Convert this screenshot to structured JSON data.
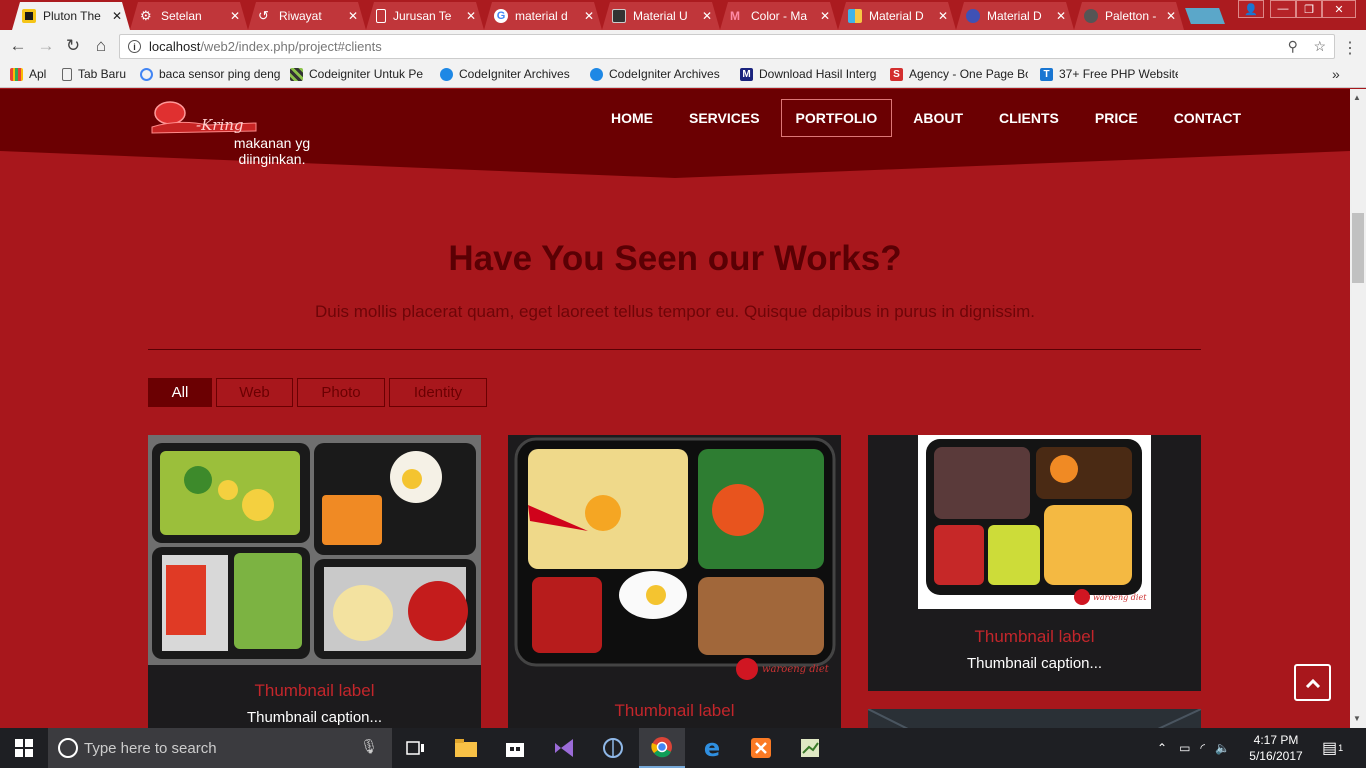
{
  "browser": {
    "tabs": [
      {
        "title": "Pluton The",
        "icon": "pluton-favicon-icon",
        "color": "#f5c518",
        "active": true
      },
      {
        "title": "Setelan",
        "icon": "gear-icon",
        "color": "#ffffff"
      },
      {
        "title": "Riwayat",
        "icon": "history-icon",
        "color": "#ffffff"
      },
      {
        "title": "Jurusan Te",
        "icon": "document-icon",
        "color": "#ffffff"
      },
      {
        "title": "material d",
        "icon": "google-icon",
        "color": "#4285f4"
      },
      {
        "title": "Material U",
        "icon": "book-icon",
        "color": "#333333"
      },
      {
        "title": "Color - Ma",
        "icon": "material-color-icon",
        "color": "#e34b6b"
      },
      {
        "title": "Material D",
        "icon": "material-design-icon",
        "color": "#3fb3e8"
      },
      {
        "title": "Material D",
        "icon": "shield-icon",
        "color": "#3f51b5"
      },
      {
        "title": "Paletton -",
        "icon": "paletton-icon",
        "color": "#555555"
      }
    ],
    "url_host": "localhost",
    "url_path": "/web2/index.php/project#clients",
    "bookmarks": [
      {
        "label": "Apl",
        "icon": "apps-grid-icon",
        "color": "#e94235"
      },
      {
        "label": "Tab Baru",
        "icon": "page-icon",
        "color": "#ffffff"
      },
      {
        "label": "baca sensor ping deng",
        "icon": "google-icon",
        "color": "#4285f4"
      },
      {
        "label": "Codeigniter Untuk Pe",
        "icon": "site-icon",
        "color": "#555555"
      },
      {
        "label": "CodeIgniter Archives",
        "icon": "codeigniter-icon",
        "color": "#1e88e5"
      },
      {
        "label": "CodeIgniter Archives",
        "icon": "codeigniter-icon",
        "color": "#1e88e5"
      },
      {
        "label": "Download Hasil Interg",
        "icon": "m-icon",
        "color": "#1a237e"
      },
      {
        "label": "Agency - One Page Bo",
        "icon": "s-icon",
        "color": "#d32f2f"
      },
      {
        "label": "37+ Free PHP Website",
        "icon": "t-icon",
        "color": "#1976d2"
      }
    ]
  },
  "site": {
    "leftover_text": "makanan yg diinginkan.",
    "nav": [
      {
        "label": "HOME",
        "active": false
      },
      {
        "label": "SERVICES",
        "active": false
      },
      {
        "label": "PORTFOLIO",
        "active": true
      },
      {
        "label": "ABOUT",
        "active": false
      },
      {
        "label": "CLIENTS",
        "active": false
      },
      {
        "label": "PRICE",
        "active": false
      },
      {
        "label": "CONTACT",
        "active": false
      }
    ],
    "section_title": "Have You Seen our Works?",
    "section_subtitle": "Duis mollis placerat quam, eget laoreet tellus tempor eu. Quisque dapibus in purus in dignissim.",
    "filters": [
      {
        "label": "All",
        "active": true
      },
      {
        "label": "Web",
        "active": false
      },
      {
        "label": "Photo",
        "active": false
      },
      {
        "label": "Identity",
        "active": false
      }
    ],
    "cards": [
      {
        "label": "Thumbnail label",
        "caption": "Thumbnail caption..."
      },
      {
        "label": "Thumbnail label",
        "caption": "",
        "watermark": "waroeng diet"
      },
      {
        "label": "Thumbnail label",
        "caption": "Thumbnail caption...",
        "watermark": "waroeng diet"
      }
    ]
  },
  "taskbar": {
    "search_placeholder": "Type here to search",
    "time": "4:17 PM",
    "date": "5/16/2017",
    "notification_count": "1"
  },
  "colors": {
    "page_bg": "#a8171c",
    "nav_bg": "#6b0002",
    "title_color": "#5a0004",
    "card_bg": "#1c1b1d",
    "label_color": "#c3262b"
  }
}
